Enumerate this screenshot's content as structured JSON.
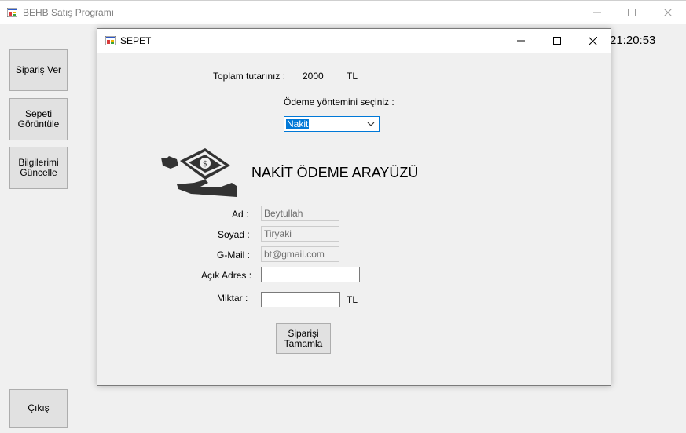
{
  "main_window": {
    "title": "BEHB Satış Programı",
    "clock": "21:20:53",
    "buttons": {
      "order": "Sipariş Ver",
      "cart": "Sepeti\nGörüntüle",
      "profile": "Bilgilerimi\nGüncelle",
      "exit": "Çıkış"
    }
  },
  "dialog": {
    "title": "SEPET",
    "total_label": "Toplam tutarınız :",
    "total_value": "2000",
    "currency": "TL",
    "payment_prompt": "Ödeme yöntemini seçiniz :",
    "payment_selected": "Nakit",
    "heading": "NAKİT ÖDEME ARAYÜZÜ",
    "fields": {
      "name_label": "Ad :",
      "name_value": "Beytullah",
      "surname_label": "Soyad :",
      "surname_value": "Tiryaki",
      "email_label": "G-Mail :",
      "email_value": "bt@gmail.com",
      "address_label": "Açık Adres :",
      "address_value": "",
      "amount_label": "Miktar :",
      "amount_value": "",
      "amount_unit": "TL"
    },
    "submit": "Siparişi\nTamamla"
  },
  "icons": {
    "app": "app-window-icon",
    "cash": "cash-hand-icon",
    "dropdown": "chevron-down-icon"
  }
}
